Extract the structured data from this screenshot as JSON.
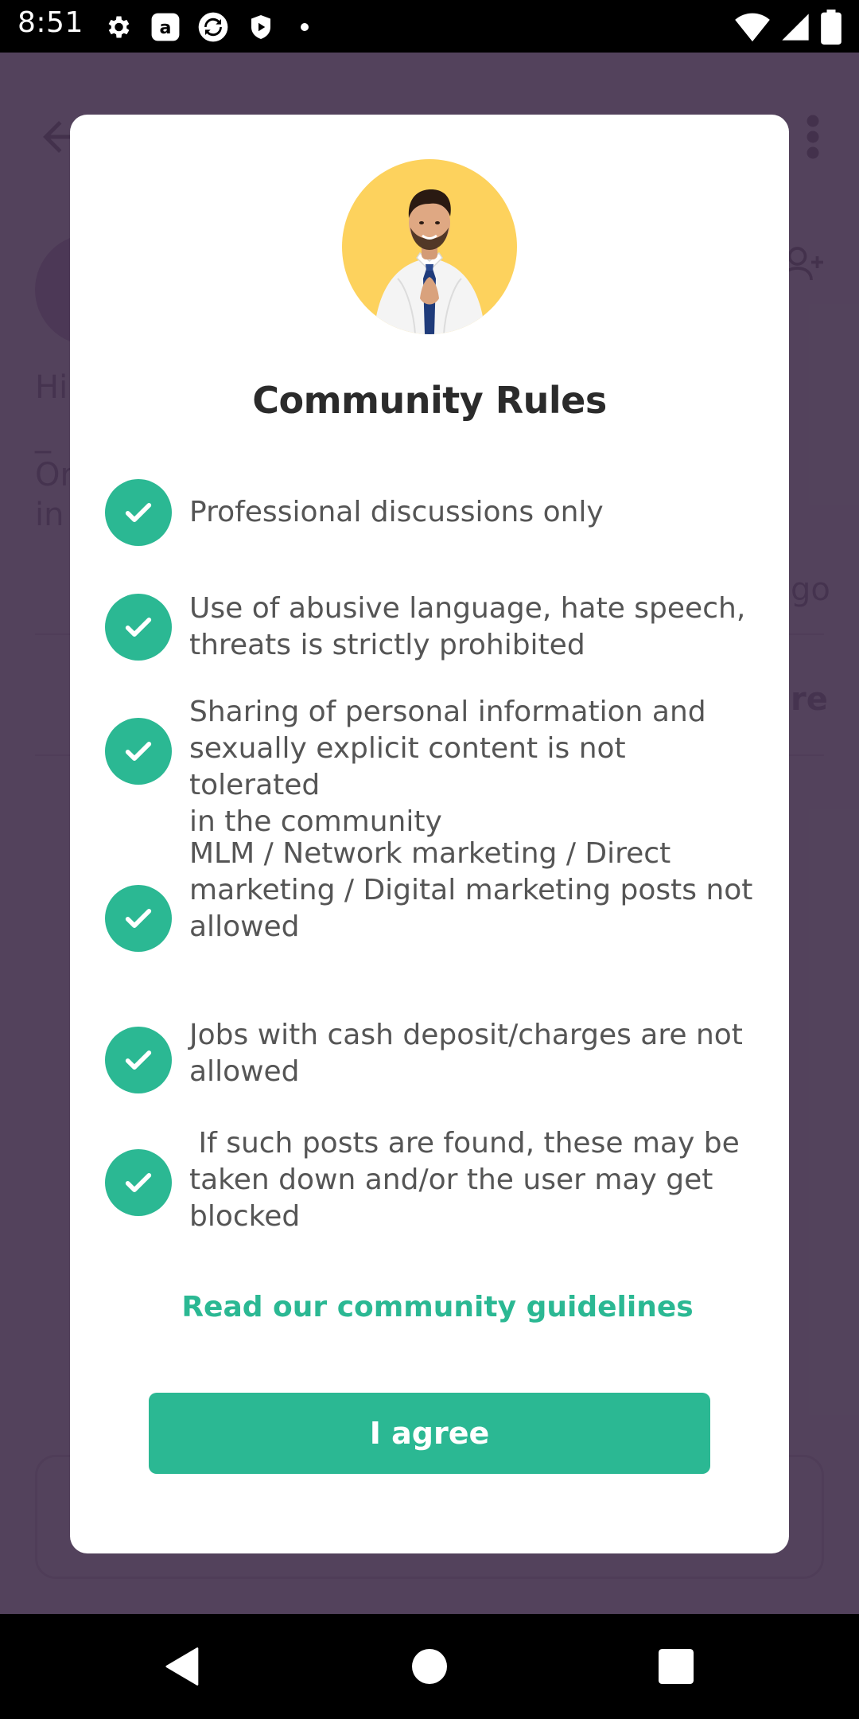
{
  "status_bar": {
    "time": "8:51",
    "left_icons": [
      "settings-icon",
      "amazon-icon",
      "sync-icon",
      "shield-play-icon",
      "dot-icon"
    ],
    "right_icons": [
      "wifi-icon",
      "signal-icon",
      "battery-icon"
    ]
  },
  "background": {
    "text_hi": "Hi",
    "text_dash": "_",
    "text_or": "Or",
    "text_in": "in",
    "text_ago": "go",
    "text_re": "re"
  },
  "dialog": {
    "title": "Community Rules",
    "rules": [
      "Professional discussions only",
      "Use of abusive language, hate speech,\nthreats is strictly prohibited",
      "Sharing of personal information and\nsexually explicit content is not tolerated\nin the community",
      "MLM / Network marketing / Direct\nmarketing / Digital marketing posts not\nallowed",
      "Jobs with cash deposit/charges are not\nallowed",
      " If such posts are found, these may be\ntaken down and/or the user may get\nblocked"
    ],
    "link_label": "Read our community guidelines",
    "agree_label": "I agree"
  },
  "colors": {
    "accent": "#2bb893",
    "avatar_bg": "#fdd25d",
    "scrim": "#3a2844"
  }
}
